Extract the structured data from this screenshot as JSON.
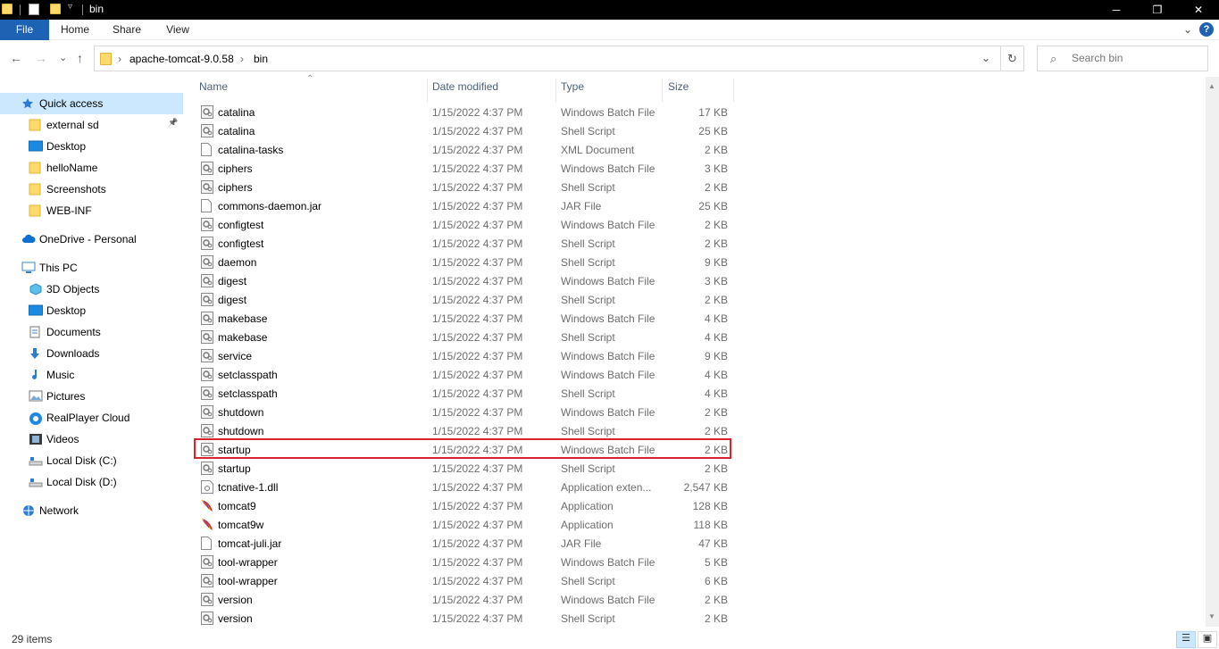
{
  "window": {
    "title": "bin",
    "minimize": "─",
    "maximize": "❐",
    "close": "✕"
  },
  "ribbon": {
    "tabs": [
      "File",
      "Home",
      "Share",
      "View"
    ],
    "collapse": "⌄",
    "help": "?"
  },
  "nav": {
    "back": "←",
    "forward": "→",
    "recent": "⌄",
    "up": "↑",
    "refresh": "↻"
  },
  "address": {
    "segments": [
      "apache-tomcat-9.0.58",
      "bin"
    ],
    "separator": "›",
    "dropdown": "⌄"
  },
  "search": {
    "placeholder": "Search bin"
  },
  "sidebar": {
    "items": [
      {
        "label": "Quick access",
        "icon": "star-icon",
        "level": 0,
        "active": true
      },
      {
        "label": "external sd",
        "icon": "folder-icon",
        "level": 1,
        "pinned": true
      },
      {
        "label": "Desktop",
        "icon": "desktop-icon",
        "level": 1
      },
      {
        "label": "helloName",
        "icon": "folder-icon",
        "level": 1
      },
      {
        "label": "Screenshots",
        "icon": "folder-icon",
        "level": 1
      },
      {
        "label": "WEB-INF",
        "icon": "folder-icon",
        "level": 1
      },
      {
        "label": "OneDrive - Personal",
        "icon": "cloud-icon",
        "level": 0
      },
      {
        "label": "This PC",
        "icon": "computer-icon",
        "level": 0
      },
      {
        "label": "3D Objects",
        "icon": "cube-icon",
        "level": 1
      },
      {
        "label": "Desktop",
        "icon": "desktop-icon",
        "level": 1
      },
      {
        "label": "Documents",
        "icon": "documents-icon",
        "level": 1
      },
      {
        "label": "Downloads",
        "icon": "download-icon",
        "level": 1
      },
      {
        "label": "Music",
        "icon": "music-icon",
        "level": 1
      },
      {
        "label": "Pictures",
        "icon": "pictures-icon",
        "level": 1
      },
      {
        "label": "RealPlayer Cloud",
        "icon": "realplayer-icon",
        "level": 1
      },
      {
        "label": "Videos",
        "icon": "video-icon",
        "level": 1
      },
      {
        "label": "Local Disk (C:)",
        "icon": "drive-icon",
        "level": 1
      },
      {
        "label": "Local Disk (D:)",
        "icon": "drive-icon",
        "level": 1
      },
      {
        "label": "Network",
        "icon": "network-icon",
        "level": 0
      }
    ]
  },
  "columns": {
    "name": "Name",
    "date": "Date modified",
    "type": "Type",
    "size": "Size"
  },
  "files": [
    {
      "name": "catalina",
      "date": "1/15/2022 4:37 PM",
      "type": "Windows Batch File",
      "size": "17 KB",
      "icon": "gear-file-icon"
    },
    {
      "name": "catalina",
      "date": "1/15/2022 4:37 PM",
      "type": "Shell Script",
      "size": "25 KB",
      "icon": "gear-file-icon"
    },
    {
      "name": "catalina-tasks",
      "date": "1/15/2022 4:37 PM",
      "type": "XML Document",
      "size": "2 KB",
      "icon": "blank-file-icon"
    },
    {
      "name": "ciphers",
      "date": "1/15/2022 4:37 PM",
      "type": "Windows Batch File",
      "size": "3 KB",
      "icon": "gear-file-icon"
    },
    {
      "name": "ciphers",
      "date": "1/15/2022 4:37 PM",
      "type": "Shell Script",
      "size": "2 KB",
      "icon": "gear-file-icon"
    },
    {
      "name": "commons-daemon.jar",
      "date": "1/15/2022 4:37 PM",
      "type": "JAR File",
      "size": "25 KB",
      "icon": "blank-file-icon"
    },
    {
      "name": "configtest",
      "date": "1/15/2022 4:37 PM",
      "type": "Windows Batch File",
      "size": "2 KB",
      "icon": "gear-file-icon"
    },
    {
      "name": "configtest",
      "date": "1/15/2022 4:37 PM",
      "type": "Shell Script",
      "size": "2 KB",
      "icon": "gear-file-icon"
    },
    {
      "name": "daemon",
      "date": "1/15/2022 4:37 PM",
      "type": "Shell Script",
      "size": "9 KB",
      "icon": "gear-file-icon"
    },
    {
      "name": "digest",
      "date": "1/15/2022 4:37 PM",
      "type": "Windows Batch File",
      "size": "3 KB",
      "icon": "gear-file-icon"
    },
    {
      "name": "digest",
      "date": "1/15/2022 4:37 PM",
      "type": "Shell Script",
      "size": "2 KB",
      "icon": "gear-file-icon"
    },
    {
      "name": "makebase",
      "date": "1/15/2022 4:37 PM",
      "type": "Windows Batch File",
      "size": "4 KB",
      "icon": "gear-file-icon"
    },
    {
      "name": "makebase",
      "date": "1/15/2022 4:37 PM",
      "type": "Shell Script",
      "size": "4 KB",
      "icon": "gear-file-icon"
    },
    {
      "name": "service",
      "date": "1/15/2022 4:37 PM",
      "type": "Windows Batch File",
      "size": "9 KB",
      "icon": "gear-file-icon"
    },
    {
      "name": "setclasspath",
      "date": "1/15/2022 4:37 PM",
      "type": "Windows Batch File",
      "size": "4 KB",
      "icon": "gear-file-icon"
    },
    {
      "name": "setclasspath",
      "date": "1/15/2022 4:37 PM",
      "type": "Shell Script",
      "size": "4 KB",
      "icon": "gear-file-icon"
    },
    {
      "name": "shutdown",
      "date": "1/15/2022 4:37 PM",
      "type": "Windows Batch File",
      "size": "2 KB",
      "icon": "gear-file-icon"
    },
    {
      "name": "shutdown",
      "date": "1/15/2022 4:37 PM",
      "type": "Shell Script",
      "size": "2 KB",
      "icon": "gear-file-icon"
    },
    {
      "name": "startup",
      "date": "1/15/2022 4:37 PM",
      "type": "Windows Batch File",
      "size": "2 KB",
      "icon": "gear-file-icon",
      "highlighted": true
    },
    {
      "name": "startup",
      "date": "1/15/2022 4:37 PM",
      "type": "Shell Script",
      "size": "2 KB",
      "icon": "gear-file-icon"
    },
    {
      "name": "tcnative-1.dll",
      "date": "1/15/2022 4:37 PM",
      "type": "Application exten...",
      "size": "2,547 KB",
      "icon": "dll-file-icon"
    },
    {
      "name": "tomcat9",
      "date": "1/15/2022 4:37 PM",
      "type": "Application",
      "size": "128 KB",
      "icon": "tomcat-feather-icon"
    },
    {
      "name": "tomcat9w",
      "date": "1/15/2022 4:37 PM",
      "type": "Application",
      "size": "118 KB",
      "icon": "tomcat-feather-icon"
    },
    {
      "name": "tomcat-juli.jar",
      "date": "1/15/2022 4:37 PM",
      "type": "JAR File",
      "size": "47 KB",
      "icon": "blank-file-icon"
    },
    {
      "name": "tool-wrapper",
      "date": "1/15/2022 4:37 PM",
      "type": "Windows Batch File",
      "size": "5 KB",
      "icon": "gear-file-icon"
    },
    {
      "name": "tool-wrapper",
      "date": "1/15/2022 4:37 PM",
      "type": "Shell Script",
      "size": "6 KB",
      "icon": "gear-file-icon"
    },
    {
      "name": "version",
      "date": "1/15/2022 4:37 PM",
      "type": "Windows Batch File",
      "size": "2 KB",
      "icon": "gear-file-icon"
    },
    {
      "name": "version",
      "date": "1/15/2022 4:37 PM",
      "type": "Shell Script",
      "size": "2 KB",
      "icon": "gear-file-icon"
    }
  ],
  "status": {
    "count": "29 items"
  },
  "colors": {
    "accent": "#1e62b4",
    "selection": "#cce8ff",
    "highlight_border": "#d9232e",
    "folder": "#ffd96a"
  }
}
